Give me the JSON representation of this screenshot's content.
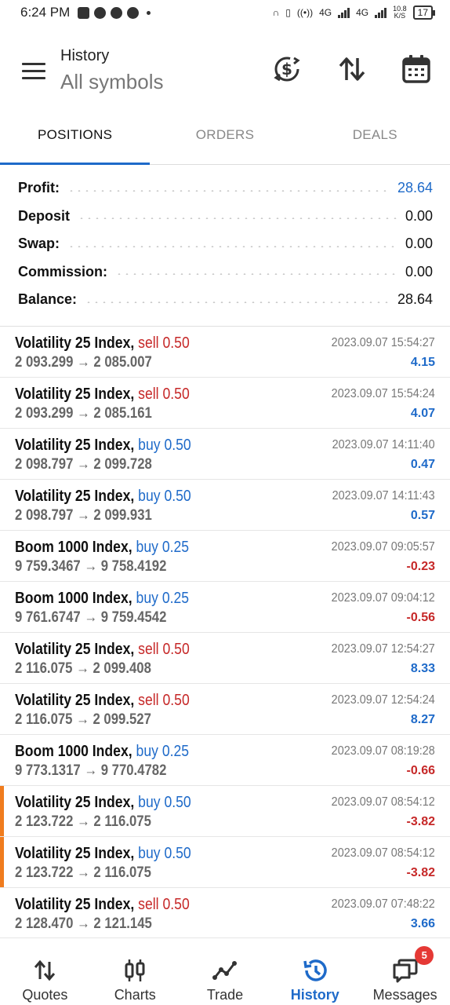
{
  "status_bar": {
    "time": "6:24 PM",
    "net_label_1": "4G",
    "net_label_2": "4G",
    "net_speed_value": "10.8",
    "net_speed_unit": "K/S",
    "battery": "17"
  },
  "header": {
    "title": "History",
    "subtitle": "All symbols",
    "icons": [
      "currency-switch-icon",
      "sort-icon",
      "calendar-icon"
    ]
  },
  "tabs": [
    {
      "label": "POSITIONS",
      "active": true
    },
    {
      "label": "ORDERS",
      "active": false
    },
    {
      "label": "DEALS",
      "active": false
    }
  ],
  "summary": [
    {
      "label": "Profit:",
      "value": "28.64",
      "highlight": true
    },
    {
      "label": "Deposit",
      "value": "0.00",
      "highlight": false
    },
    {
      "label": "Swap:",
      "value": "0.00",
      "highlight": false
    },
    {
      "label": "Commission:",
      "value": "0.00",
      "highlight": false
    },
    {
      "label": "Balance:",
      "value": "28.64",
      "highlight": false
    }
  ],
  "positions": [
    {
      "symbol": "Volatility 25 Index,",
      "side": "sell",
      "volume": "0.50",
      "open": "2 093.299",
      "close": "2 085.007",
      "time": "2023.09.07 15:54:27",
      "profit": "4.15",
      "flag": false
    },
    {
      "symbol": "Volatility 25 Index,",
      "side": "sell",
      "volume": "0.50",
      "open": "2 093.299",
      "close": "2 085.161",
      "time": "2023.09.07 15:54:24",
      "profit": "4.07",
      "flag": false
    },
    {
      "symbol": "Volatility 25 Index,",
      "side": "buy",
      "volume": "0.50",
      "open": "2 098.797",
      "close": "2 099.728",
      "time": "2023.09.07 14:11:40",
      "profit": "0.47",
      "flag": false
    },
    {
      "symbol": "Volatility 25 Index,",
      "side": "buy",
      "volume": "0.50",
      "open": "2 098.797",
      "close": "2 099.931",
      "time": "2023.09.07 14:11:43",
      "profit": "0.57",
      "flag": false
    },
    {
      "symbol": "Boom 1000 Index,",
      "side": "buy",
      "volume": "0.25",
      "open": "9 759.3467",
      "close": "9 758.4192",
      "time": "2023.09.07 09:05:57",
      "profit": "-0.23",
      "flag": false
    },
    {
      "symbol": "Boom 1000 Index,",
      "side": "buy",
      "volume": "0.25",
      "open": "9 761.6747",
      "close": "9 759.4542",
      "time": "2023.09.07 09:04:12",
      "profit": "-0.56",
      "flag": false
    },
    {
      "symbol": "Volatility 25 Index,",
      "side": "sell",
      "volume": "0.50",
      "open": "2 116.075",
      "close": "2 099.408",
      "time": "2023.09.07 12:54:27",
      "profit": "8.33",
      "flag": false
    },
    {
      "symbol": "Volatility 25 Index,",
      "side": "sell",
      "volume": "0.50",
      "open": "2 116.075",
      "close": "2 099.527",
      "time": "2023.09.07 12:54:24",
      "profit": "8.27",
      "flag": false
    },
    {
      "symbol": "Boom 1000 Index,",
      "side": "buy",
      "volume": "0.25",
      "open": "9 773.1317",
      "close": "9 770.4782",
      "time": "2023.09.07 08:19:28",
      "profit": "-0.66",
      "flag": false
    },
    {
      "symbol": "Volatility 25 Index,",
      "side": "buy",
      "volume": "0.50",
      "open": "2 123.722",
      "close": "2 116.075",
      "time": "2023.09.07 08:54:12",
      "profit": "-3.82",
      "flag": true
    },
    {
      "symbol": "Volatility 25 Index,",
      "side": "buy",
      "volume": "0.50",
      "open": "2 123.722",
      "close": "2 116.075",
      "time": "2023.09.07 08:54:12",
      "profit": "-3.82",
      "flag": true
    },
    {
      "symbol": "Volatility 25 Index,",
      "side": "sell",
      "volume": "0.50",
      "open": "2 128.470",
      "close": "2 121.145",
      "time": "2023.09.07 07:48:22",
      "profit": "3.66",
      "flag": false
    }
  ],
  "price_arrow": "→",
  "bottom_nav": [
    {
      "label": "Quotes",
      "icon": "quotes-icon",
      "active": false
    },
    {
      "label": "Charts",
      "icon": "charts-icon",
      "active": false
    },
    {
      "label": "Trade",
      "icon": "trade-icon",
      "active": false
    },
    {
      "label": "History",
      "icon": "history-icon",
      "active": true
    },
    {
      "label": "Messages",
      "icon": "messages-icon",
      "active": false,
      "badge": "5"
    }
  ],
  "colors": {
    "accent": "#1e6ac9",
    "sell": "#c62828",
    "flag": "#f07c1e"
  }
}
